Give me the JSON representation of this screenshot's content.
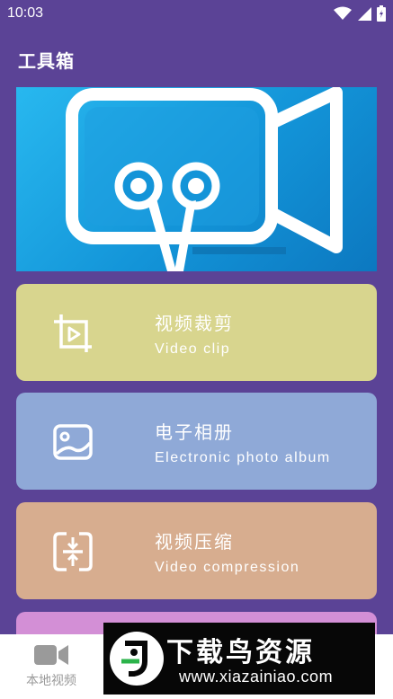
{
  "status_bar": {
    "time": "10:03",
    "icons": [
      "wifi-icon",
      "signal-icon",
      "battery-icon"
    ]
  },
  "header": {
    "title": "工具箱"
  },
  "banner": {
    "icon": "video-camera-scissors-icon"
  },
  "cards": [
    {
      "title": "视频裁剪",
      "subtitle": "Video clip",
      "icon": "crop-icon",
      "color": "#d8d58e"
    },
    {
      "title": "电子相册",
      "subtitle": "Electronic photo album",
      "icon": "photo-album-icon",
      "color": "#8fa9d7"
    },
    {
      "title": "视频压缩",
      "subtitle": "Video compression",
      "icon": "compress-icon",
      "color": "#d7ad8f"
    },
    {
      "color": "#d38fd6"
    }
  ],
  "bottom_nav": {
    "items": [
      {
        "label": "本地视频",
        "icon": "video-camera-icon"
      }
    ]
  },
  "watermark": {
    "title": "下载鸟资源",
    "url": "www.xiazainiao.com"
  },
  "colors": {
    "background": "#5b4396",
    "banner": "#1394d8"
  }
}
